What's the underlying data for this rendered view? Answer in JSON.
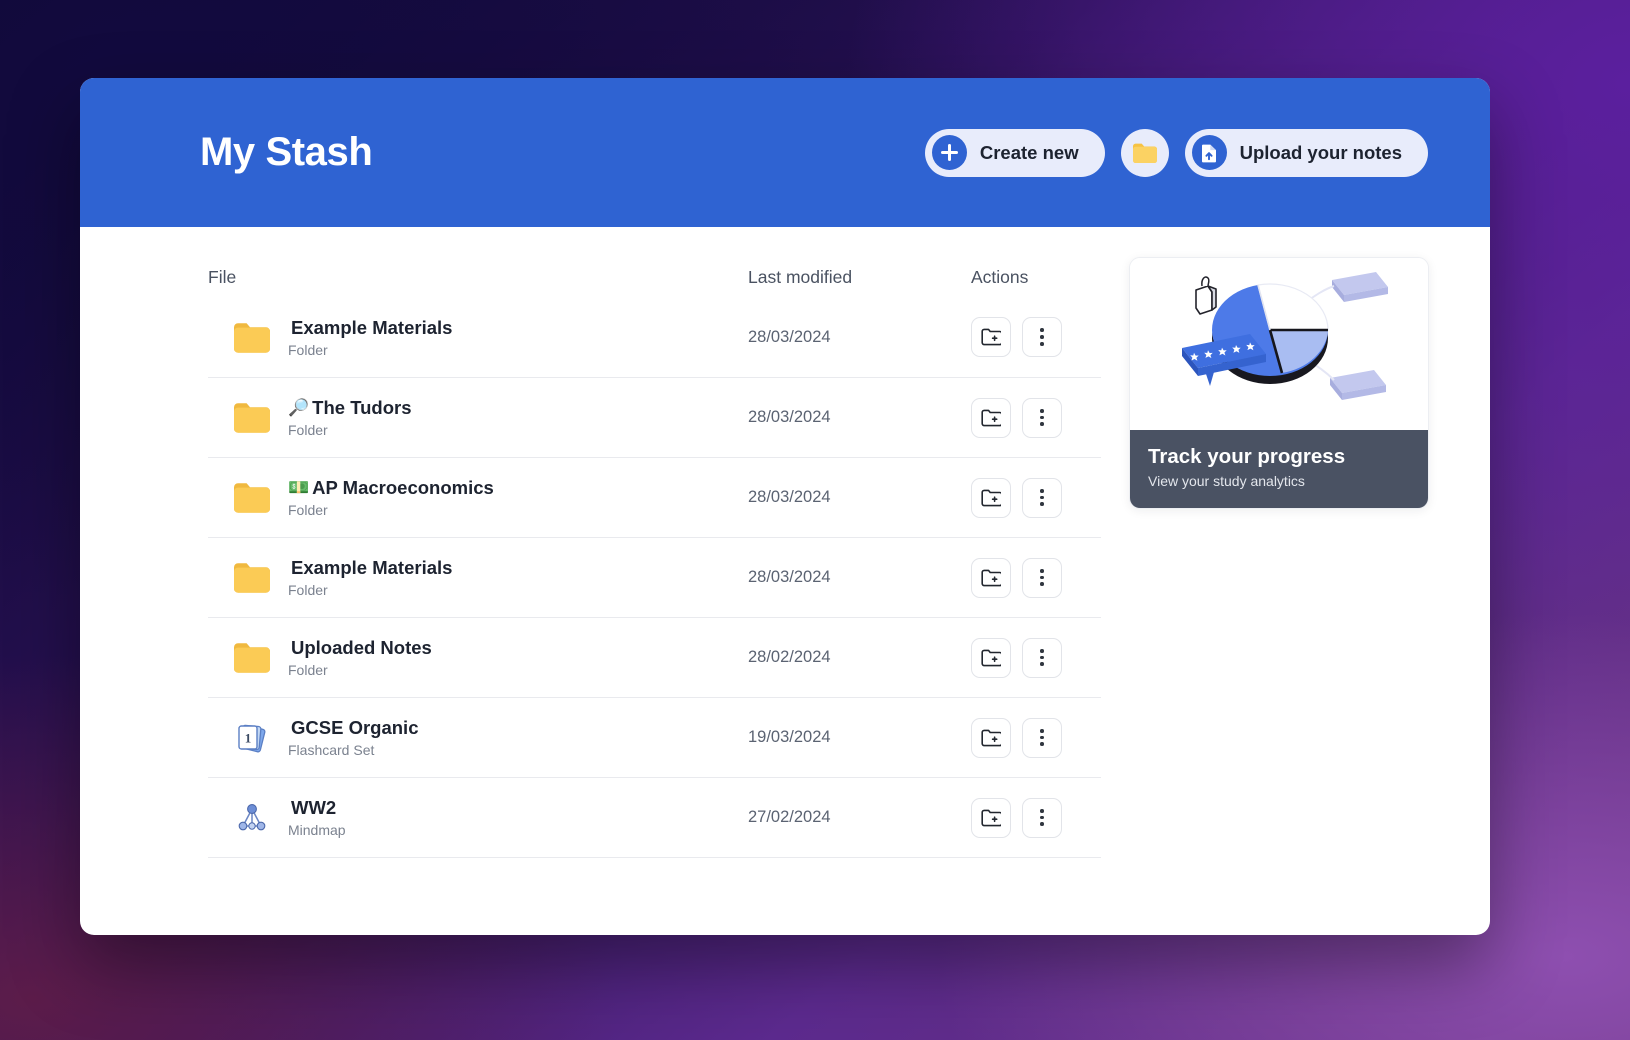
{
  "window": {
    "title": "My Stash"
  },
  "header": {
    "create_new_label": "Create new",
    "new_folder_icon": "folder-icon",
    "upload_label": "Upload your notes",
    "plus_icon": "plus-icon",
    "upload_icon": "file-upload-icon",
    "accent_color": "#2f63d2",
    "pill_color": "#e8ecfb"
  },
  "table": {
    "columns": {
      "file": "File",
      "modified": "Last modified",
      "actions": "Actions"
    },
    "rows": [
      {
        "icon": "folder-icon",
        "emoji": "",
        "name": "Example Materials",
        "type": "Folder",
        "modified": "28/03/2024"
      },
      {
        "icon": "folder-icon",
        "emoji": "🔎",
        "name": "The Tudors",
        "type": "Folder",
        "modified": "28/03/2024"
      },
      {
        "icon": "folder-icon",
        "emoji": "💵",
        "name": "AP Macroeconomics",
        "type": "Folder",
        "modified": "28/03/2024"
      },
      {
        "icon": "folder-icon",
        "emoji": "",
        "name": "Example Materials",
        "type": "Folder",
        "modified": "28/03/2024"
      },
      {
        "icon": "folder-icon",
        "emoji": "",
        "name": "Uploaded Notes",
        "type": "Folder",
        "modified": "28/02/2024"
      },
      {
        "icon": "flashcard-icon",
        "emoji": "",
        "name": "GCSE Organic",
        "type": "Flashcard Set",
        "modified": "19/03/2024"
      },
      {
        "icon": "mindmap-icon",
        "emoji": "",
        "name": "WW2",
        "type": "Mindmap",
        "modified": "27/02/2024"
      }
    ],
    "row_actions": {
      "move_to_folder_icon": "folder-add-icon",
      "more_options_icon": "kebab-menu-icon"
    }
  },
  "promo": {
    "title": "Track your progress",
    "subtitle": "View your study analytics",
    "illustration": "analytics-pie-chart-illustration",
    "caption_bg": "#4a5263"
  }
}
